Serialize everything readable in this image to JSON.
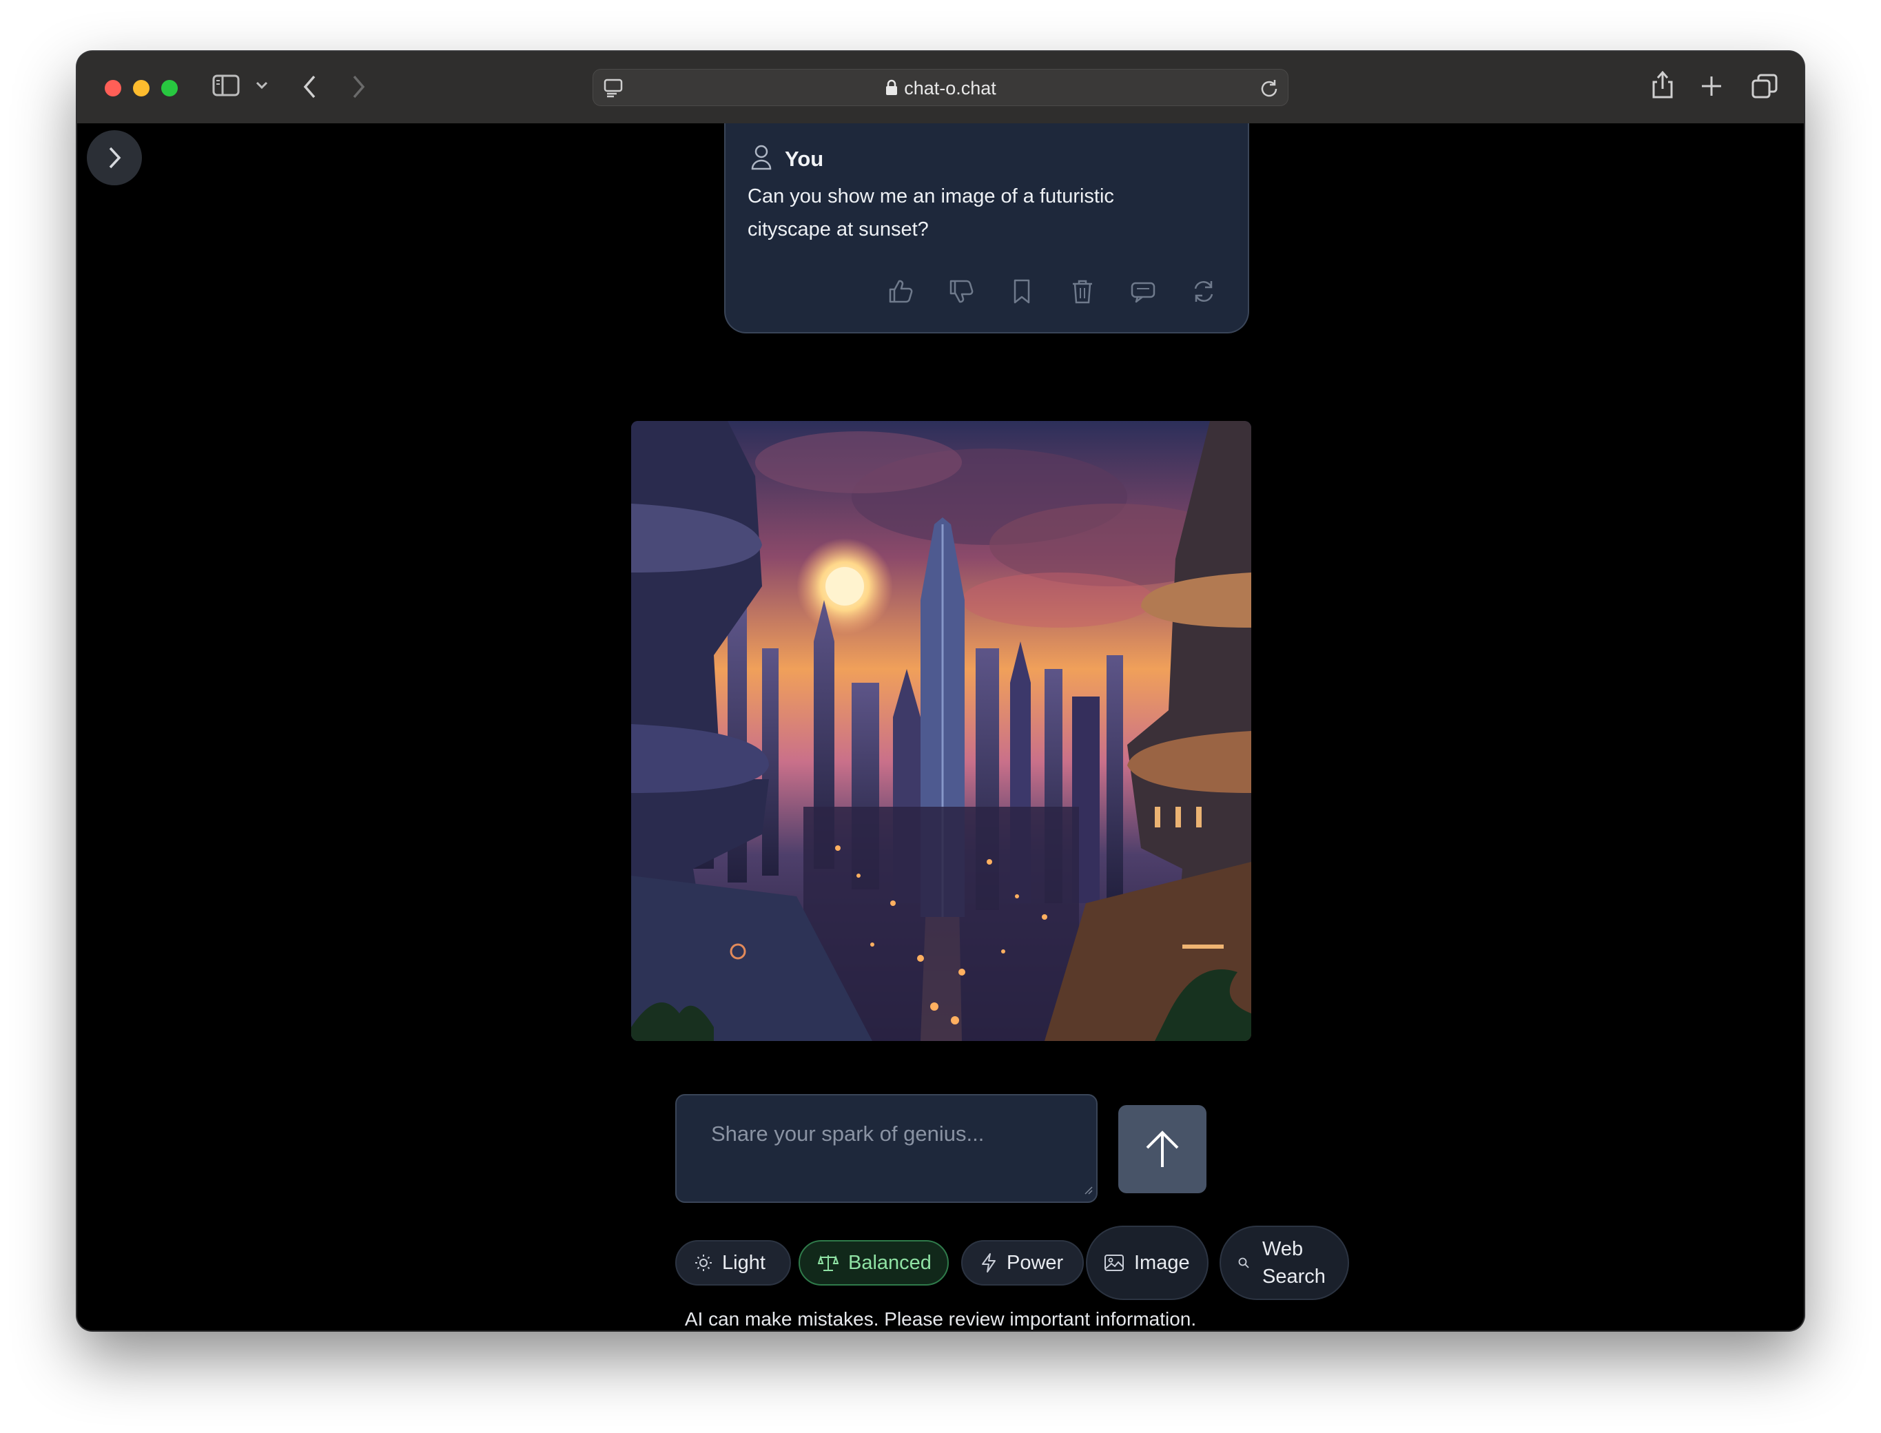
{
  "browser": {
    "url": "chat-o.chat"
  },
  "message": {
    "author": "You",
    "text": "Can you show me an image of a futuristic cityscape at sunset?",
    "actions": [
      "thumbs-up",
      "thumbs-down",
      "bookmark",
      "delete",
      "comment",
      "regenerate"
    ]
  },
  "composer": {
    "placeholder": "Share your spark of genius..."
  },
  "modes": [
    {
      "label": "Light",
      "icon": "sun-icon",
      "selected": false
    },
    {
      "label": "Balanced",
      "icon": "scale-icon",
      "selected": true
    },
    {
      "label": "Power",
      "icon": "bolt-icon",
      "selected": false
    },
    {
      "label": "Image",
      "icon": "image-icon",
      "selected": false
    },
    {
      "label": "Web Search",
      "icon": "search-icon",
      "selected": false
    }
  ],
  "web_search_line1": "Web",
  "web_search_line2": "Search",
  "disclaimer": "AI can make mistakes. Please review important information.",
  "colors": {
    "card_bg": "#1e283b",
    "send_bg": "#485468",
    "active_mode": "#8fe2a4"
  }
}
